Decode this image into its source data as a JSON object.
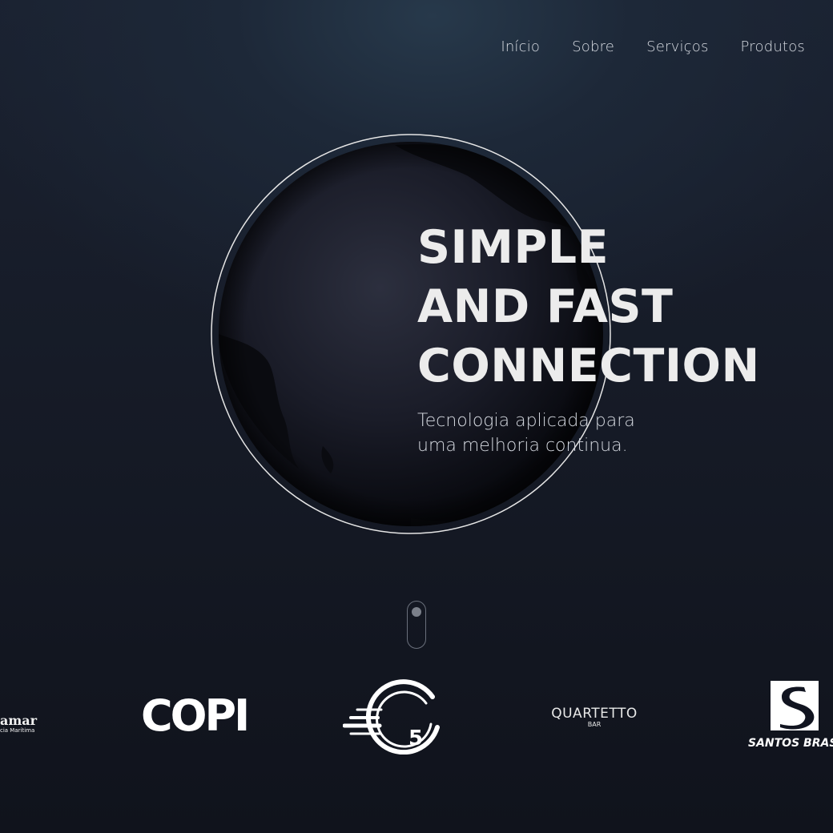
{
  "nav": {
    "items": [
      {
        "label": "Início"
      },
      {
        "label": "Sobre"
      },
      {
        "label": "Serviços"
      },
      {
        "label": "Produtos"
      }
    ]
  },
  "hero": {
    "title_lines": [
      "SIMPLE",
      "AND FAST",
      "CONNECTION"
    ],
    "subtitle_lines": [
      "Tecnologia aplicada para",
      "uma melhoria continua."
    ]
  },
  "logos": {
    "amar": {
      "name": "amar",
      "tagline": "cia Marítima"
    },
    "copi": {
      "name": "COPI"
    },
    "g5": {
      "number": "5"
    },
    "quartetto": {
      "name": "QUARTETTO",
      "sub": "BAR"
    },
    "santos": {
      "name": "SANTOS BRASIL"
    }
  },
  "colors": {
    "background": "#111420",
    "heading": "#ececec",
    "nav_text": "#d8dce3",
    "globe_outline": "#e6e6e6"
  }
}
